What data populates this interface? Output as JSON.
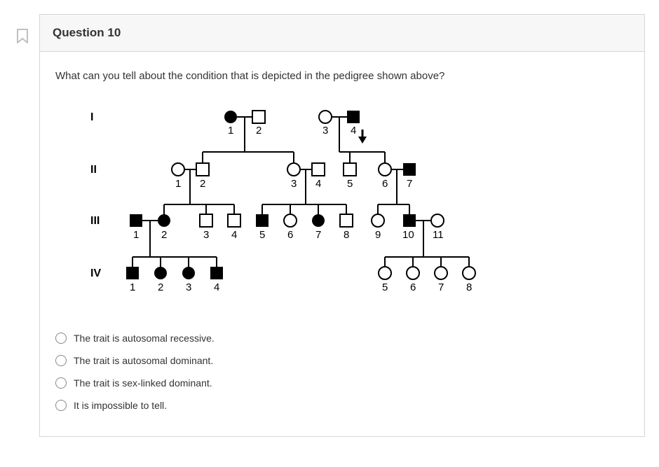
{
  "header": {
    "title": "Question 10"
  },
  "stem": "What can you tell about the condition that is depicted in the pedigree shown above?",
  "figure_alt": "Four-generation pedigree chart with affected and unaffected squares (males) and circles (females). An arrow indicates descent between generations I and II on the right couple.",
  "rows": {
    "I": "I",
    "II": "II",
    "III": "III",
    "IV": "IV"
  },
  "gen1": {
    "n1": "1",
    "n2": "2",
    "n3": "3",
    "n4": "4"
  },
  "gen2": {
    "n1": "1",
    "n2": "2",
    "n3": "3",
    "n4": "4",
    "n5": "5",
    "n6": "6",
    "n7": "7"
  },
  "gen3": {
    "n1": "1",
    "n2": "2",
    "n3": "3",
    "n4": "4",
    "n5": "5",
    "n6": "6",
    "n7": "7",
    "n8": "8",
    "n9": "9",
    "n10": "10",
    "n11": "11"
  },
  "gen4": {
    "n1": "1",
    "n2": "2",
    "n3": "3",
    "n4": "4",
    "n5": "5",
    "n6": "6",
    "n7": "7",
    "n8": "8"
  },
  "options": {
    "a": "The trait is autosomal recessive.",
    "b": "The trait is autosomal dominant.",
    "c": "The trait is sex-linked dominant.",
    "d": "It is impossible to tell."
  }
}
